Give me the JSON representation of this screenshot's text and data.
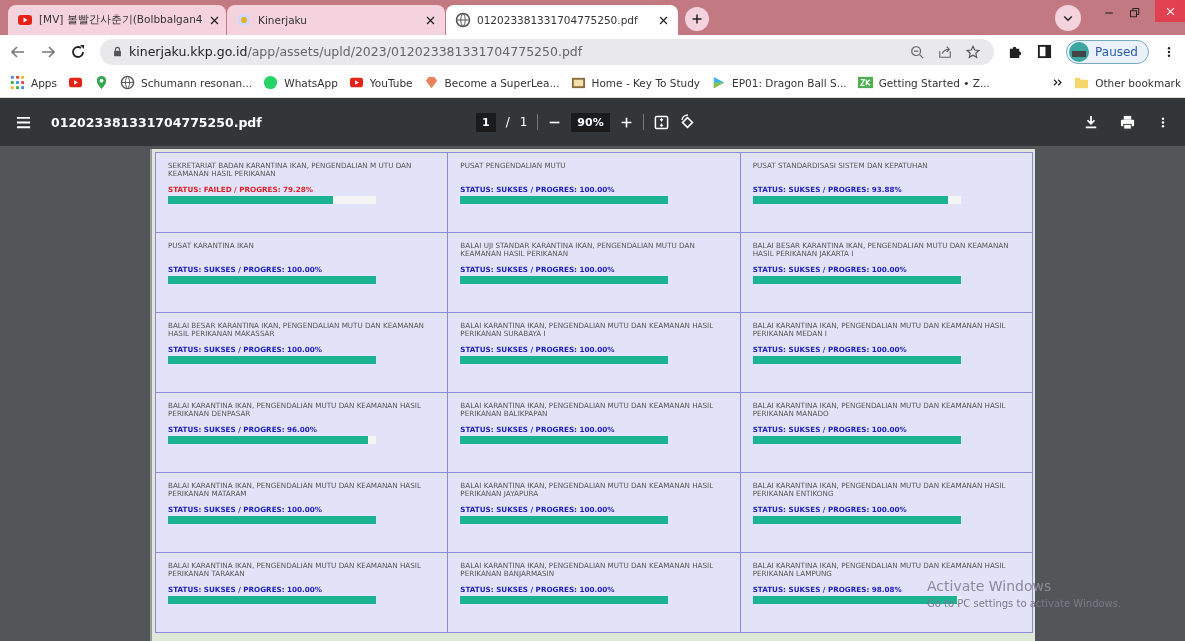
{
  "tabs": [
    {
      "title": "[MV] 볼빨간사춘기(Bolbbalgan4",
      "selected": false
    },
    {
      "title": "Kinerjaku",
      "selected": false
    },
    {
      "title": "012023381331704775250.pdf",
      "selected": true
    }
  ],
  "address": {
    "host": "kinerjaku.kkp.go.id",
    "path": "/app/assets/upld/2023/012023381331704775250.pdf"
  },
  "profile": {
    "label": "Paused"
  },
  "bookmarks": [
    {
      "label": "Apps"
    },
    {
      "label": "Schumann resonan..."
    },
    {
      "label": "WhatsApp"
    },
    {
      "label": "YouTube"
    },
    {
      "label": "Become a SuperLea..."
    },
    {
      "label": "Home - Key To Study"
    },
    {
      "label": "EP01: Dragon Ball S..."
    },
    {
      "label": "Getting Started • Z..."
    }
  ],
  "other_bookmarks": "Other bookmark",
  "pdf_toolbar": {
    "filename": "012023381331704775250.pdf",
    "page": "1",
    "page_sep": "/",
    "pages": "1",
    "zoom": "90%"
  },
  "units": [
    {
      "name": "SEKRETARIAT BADAN KARANTINA IKAN, PENGENDALIAN M UTU DAN KEAMANAN HASIL PERIKANAN",
      "status": "STATUS: FAILED / PROGRES: 79.28%",
      "failed": true,
      "level": 0.7928
    },
    {
      "name": "PUSAT PENGENDALIAN MUTU",
      "status": "STATUS: SUKSES / PROGRES: 100.00%",
      "failed": false,
      "level": 1
    },
    {
      "name": "PUSAT STANDARDISASI SISTEM DAN KEPATUHAN",
      "status": "STATUS: SUKSES / PROGRES: 93.88%",
      "failed": false,
      "level": 0.9388
    },
    {
      "name": "PUSAT KARANTINA IKAN",
      "status": "STATUS: SUKSES / PROGRES: 100.00%",
      "failed": false,
      "level": 1
    },
    {
      "name": "BALAI UJI STANDAR KARANTINA IKAN, PENGENDALIAN MUTU DAN KEAMANAN HASIL PERIKANAN",
      "status": "STATUS: SUKSES / PROGRES: 100.00%",
      "failed": false,
      "level": 1
    },
    {
      "name": "BALAI BESAR KARANTINA IKAN, PENGENDALIAN MUTU DAN KEAMANAN HASIL PERIKANAN JAKARTA I",
      "status": "STATUS: SUKSES / PROGRES: 100.00%",
      "failed": false,
      "level": 1
    },
    {
      "name": "BALAI BESAR KARANTINA IKAN, PENGENDALIAN MUTU DAN KEAMANAN HASIL PERIKANAN MAKASSAR",
      "status": "STATUS: SUKSES / PROGRES: 100.00%",
      "failed": false,
      "level": 1
    },
    {
      "name": "BALAI KARANTINA IKAN, PENGENDALIAN MUTU DAN KEAMANAN HASIL PERIKANAN SURABAYA I",
      "status": "STATUS: SUKSES / PROGRES: 100.00%",
      "failed": false,
      "level": 1
    },
    {
      "name": "BALAI KARANTINA IKAN, PENGENDALIAN MUTU DAN KEAMANAN HASIL PERIKANAN MEDAN I",
      "status": "STATUS: SUKSES / PROGRES: 100.00%",
      "failed": false,
      "level": 1
    },
    {
      "name": "BALAI KARANTINA IKAN, PENGENDALIAN MUTU DAN KEAMANAN HASIL PERIKANAN DENPASAR",
      "status": "STATUS: SUKSES / PROGRES: 96.00%",
      "failed": false,
      "level": 0.96
    },
    {
      "name": "BALAI KARANTINA IKAN, PENGENDALIAN MUTU DAN KEAMANAN HASIL PERIKANAN BALIKPAPAN",
      "status": "STATUS: SUKSES / PROGRES: 100.00%",
      "failed": false,
      "level": 1
    },
    {
      "name": "BALAI KARANTINA IKAN, PENGENDALIAN MUTU DAN KEAMANAN HASIL PERIKANAN MANADO",
      "status": "STATUS: SUKSES / PROGRES: 100.00%",
      "failed": false,
      "level": 1
    },
    {
      "name": "BALAI KARANTINA IKAN, PENGENDALIAN MUTU DAN KEAMANAN HASIL PERIKANAN MATARAM",
      "status": "STATUS: SUKSES / PROGRES: 100.00%",
      "failed": false,
      "level": 1
    },
    {
      "name": "BALAI KARANTINA IKAN, PENGENDALIAN MUTU DAN KEAMANAN HASIL PERIKANAN JAYAPURA",
      "status": "STATUS: SUKSES / PROGRES: 100.00%",
      "failed": false,
      "level": 1
    },
    {
      "name": "BALAI KARANTINA IKAN, PENGENDALIAN MUTU DAN KEAMANAN HASIL PERIKANAN ENTIKONG",
      "status": "STATUS: SUKSES / PROGRES: 100.00%",
      "failed": false,
      "level": 1
    },
    {
      "name": "BALAI KARANTINA IKAN, PENGENDALIAN MUTU DAN KEAMANAN HASIL PERIKANAN TARAKAN",
      "status": "STATUS: SUKSES / PROGRES: 100.00%",
      "failed": false,
      "level": 1
    },
    {
      "name": "BALAI KARANTINA IKAN, PENGENDALIAN MUTU DAN KEAMANAN HASIL PERIKANAN BANJARMASIN",
      "status": "STATUS: SUKSES / PROGRES: 100.00%",
      "failed": false,
      "level": 1
    },
    {
      "name": "BALAI KARANTINA IKAN, PENGENDALIAN MUTU DAN KEAMANAN HASIL PERIKANAN LAMPUNG",
      "status": "STATUS: SUKSES / PROGRES: 98.08%",
      "failed": false,
      "level": 0.9808
    }
  ],
  "activation_notice": {
    "title": "Activate Windows",
    "hint": "Go to PC settings to activate Windows."
  }
}
